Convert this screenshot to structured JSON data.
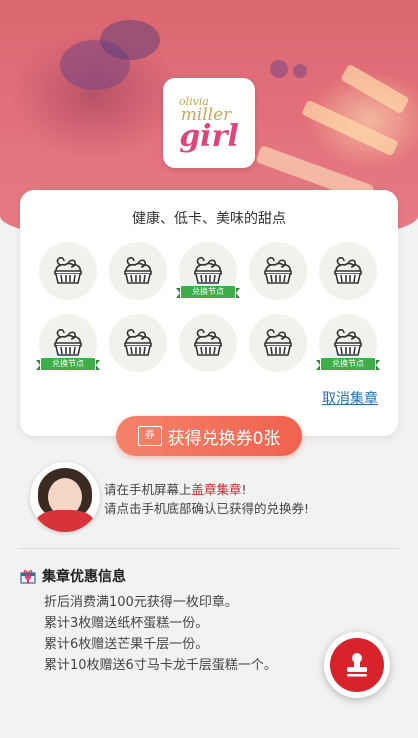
{
  "brand": {
    "logo_line1": "olivia",
    "logo_line2": "miller",
    "logo_line3": "girl"
  },
  "card": {
    "tagline": "健康、低卡、美味的甜点",
    "stamps": [
      {
        "ribbon": ""
      },
      {
        "ribbon": ""
      },
      {
        "ribbon": "兑换节点"
      },
      {
        "ribbon": ""
      },
      {
        "ribbon": ""
      },
      {
        "ribbon": "兑换节点"
      },
      {
        "ribbon": ""
      },
      {
        "ribbon": ""
      },
      {
        "ribbon": ""
      },
      {
        "ribbon": "兑换节点"
      }
    ],
    "cancel_label": "取消集章"
  },
  "voucher": {
    "icon_text": "券",
    "label": "获得兑换券0张"
  },
  "hint": {
    "line1_prefix": "请在手机屏幕上",
    "line1_highlight": "盖章集章",
    "line1_suffix": "!",
    "line2": "请点击手机底部确认已获得的兑换券!"
  },
  "info": {
    "title": "集章优惠信息",
    "rules": [
      "折后消费满100元获得一枚印章。",
      "累计3枚赠送纸杯蛋糕一份。",
      "累计6枚赠送芒果千层一份。",
      "累计10枚赠送6寸马卡龙千层蛋糕一个。"
    ]
  },
  "colors": {
    "accent": "#f0624f",
    "ribbon": "#3fae4a",
    "stamp_button": "#d8222c",
    "link": "#2a6fb5"
  },
  "icons": {
    "stamp": "cake-stamp-icon",
    "gift": "gift-icon",
    "fab": "seal-stamp-icon"
  }
}
